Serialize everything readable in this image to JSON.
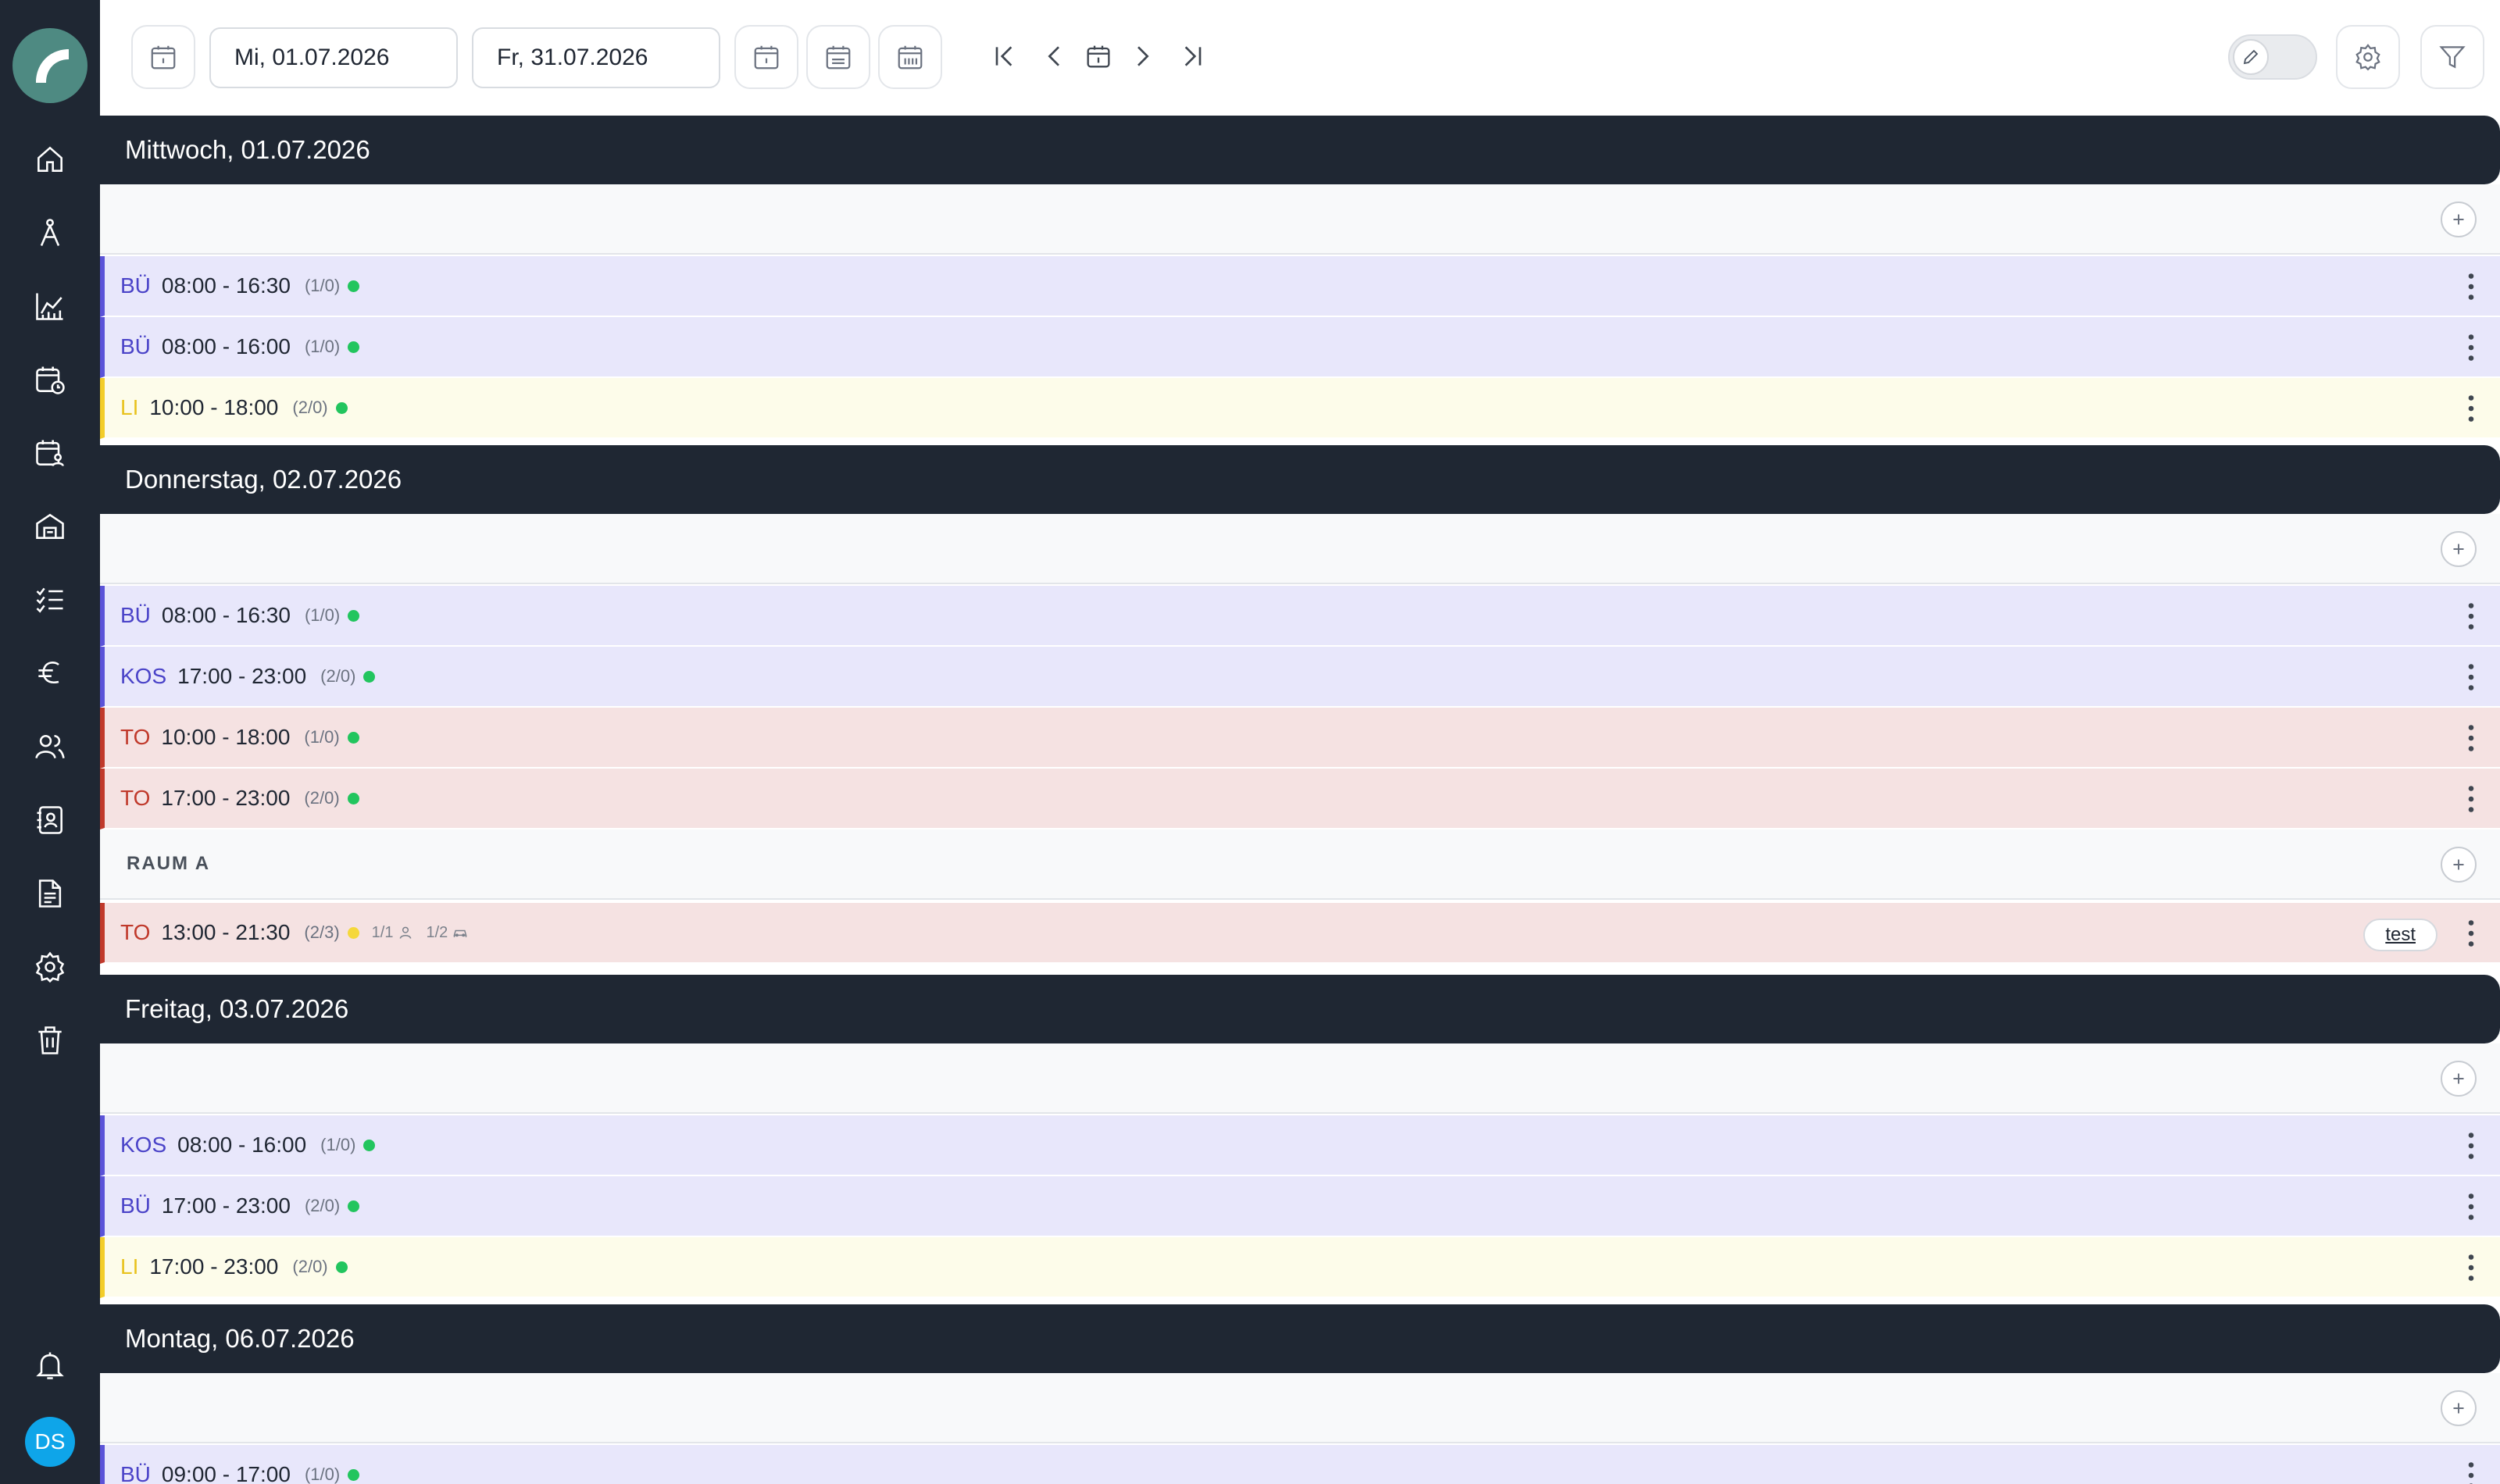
{
  "sidebar": {
    "logo": "app-logo",
    "items": [
      {
        "name": "home",
        "icon": "home-icon"
      },
      {
        "name": "compass",
        "icon": "compass-icon"
      },
      {
        "name": "statistics",
        "icon": "chart-icon"
      },
      {
        "name": "calendar-clock",
        "icon": "calendar-clock-icon"
      },
      {
        "name": "calendar-user",
        "icon": "calendar-user-icon"
      },
      {
        "name": "building",
        "icon": "building-icon"
      },
      {
        "name": "checklist",
        "icon": "checklist-icon"
      },
      {
        "name": "finance",
        "icon": "euro-icon"
      },
      {
        "name": "users",
        "icon": "users-icon"
      },
      {
        "name": "contacts",
        "icon": "contact-book-icon"
      },
      {
        "name": "documents",
        "icon": "document-icon"
      },
      {
        "name": "settings",
        "icon": "gear-icon"
      },
      {
        "name": "trash",
        "icon": "trash-icon"
      }
    ],
    "notifications_icon": "bell-icon",
    "avatar_initials": "DS"
  },
  "toolbar": {
    "start_date": "Mi,  01.07.2026",
    "end_date": "Fr,   31.07.2026",
    "colors": {
      "border": "#e3e6ea"
    }
  },
  "days": [
    {
      "header": "Mittwoch, 01.07.2026",
      "groups": [
        {
          "label": "",
          "shifts": [
            {
              "code": "BÜ",
              "time": "08:00 - 16:30",
              "count": "(1/0)",
              "status": "green",
              "type": "bu"
            },
            {
              "code": "BÜ",
              "time": "08:00 - 16:00",
              "count": "(1/0)",
              "status": "green",
              "type": "bu"
            },
            {
              "code": "LI",
              "time": "10:00 - 18:00",
              "count": "(2/0)",
              "status": "green",
              "type": "li"
            }
          ]
        }
      ]
    },
    {
      "header": "Donnerstag, 02.07.2026",
      "groups": [
        {
          "label": "",
          "shifts": [
            {
              "code": "BÜ",
              "time": "08:00 - 16:30",
              "count": "(1/0)",
              "status": "green",
              "type": "bu"
            },
            {
              "code": "KOS",
              "time": "17:00 - 23:00",
              "count": "(2/0)",
              "status": "green",
              "type": "kos"
            },
            {
              "code": "TO",
              "time": "10:00 - 18:00",
              "count": "(1/0)",
              "status": "green",
              "type": "to"
            },
            {
              "code": "TO",
              "time": "17:00 - 23:00",
              "count": "(2/0)",
              "status": "green",
              "type": "to"
            }
          ]
        },
        {
          "label": "RAUM A",
          "shifts": [
            {
              "code": "TO",
              "time": "13:00 - 21:30",
              "count": "(2/3)",
              "status": "yellow",
              "type": "to",
              "extra1": "1/1",
              "extra2": "1/2",
              "tag": "test"
            }
          ]
        }
      ]
    },
    {
      "header": "Freitag, 03.07.2026",
      "groups": [
        {
          "label": "",
          "shifts": [
            {
              "code": "KOS",
              "time": "08:00 - 16:00",
              "count": "(1/0)",
              "status": "green",
              "type": "kos"
            },
            {
              "code": "BÜ",
              "time": "17:00 - 23:00",
              "count": "(2/0)",
              "status": "green",
              "type": "bu"
            },
            {
              "code": "LI",
              "time": "17:00 - 23:00",
              "count": "(2/0)",
              "status": "green",
              "type": "li"
            }
          ]
        }
      ]
    },
    {
      "header": "Montag, 06.07.2026",
      "groups": [
        {
          "label": "",
          "shifts": [
            {
              "code": "BÜ",
              "time": "09:00 - 17:00",
              "count": "(1/0)",
              "status": "green",
              "type": "bu"
            }
          ]
        }
      ]
    }
  ]
}
